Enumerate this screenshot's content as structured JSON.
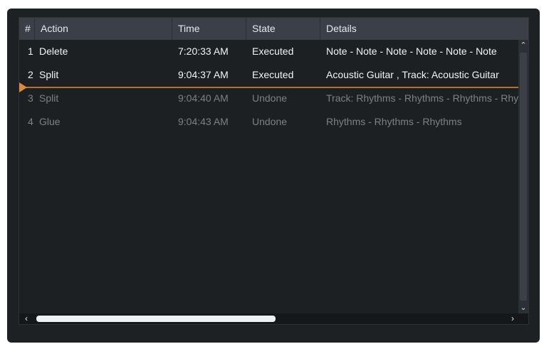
{
  "columns": {
    "num": "#",
    "action": "Action",
    "time": "Time",
    "state": "State",
    "details": "Details"
  },
  "rows": [
    {
      "num": "1",
      "action": "Delete",
      "time": "7:20:33 AM",
      "state": "Executed",
      "details": "Note - Note - Note - Note - Note - Note"
    },
    {
      "num": "2",
      "action": "Split",
      "time": "9:04:37 AM",
      "state": "Executed",
      "details": "Acoustic Guitar , Track: Acoustic Guitar"
    },
    {
      "num": "3",
      "action": "Split",
      "time": "9:04:40 AM",
      "state": "Undone",
      "details": "Track: Rhythms - Rhythms - Rhythms - Rhythms"
    },
    {
      "num": "4",
      "action": "Glue",
      "time": "9:04:43 AM",
      "state": "Undone",
      "details": "Rhythms - Rhythms - Rhythms"
    }
  ],
  "icons": {
    "scroll_up": "chevron-up-icon",
    "scroll_down": "chevron-down-icon",
    "scroll_left": "chevron-left-icon",
    "scroll_right": "chevron-right-icon",
    "undo_position": "triangle-right-icon"
  },
  "colors": {
    "background": "#1d2023",
    "header": "#3a4046",
    "executed_text": "#f2f4f6",
    "undone_text": "#7b8186",
    "undo_position_marker": "#d88a3e"
  }
}
